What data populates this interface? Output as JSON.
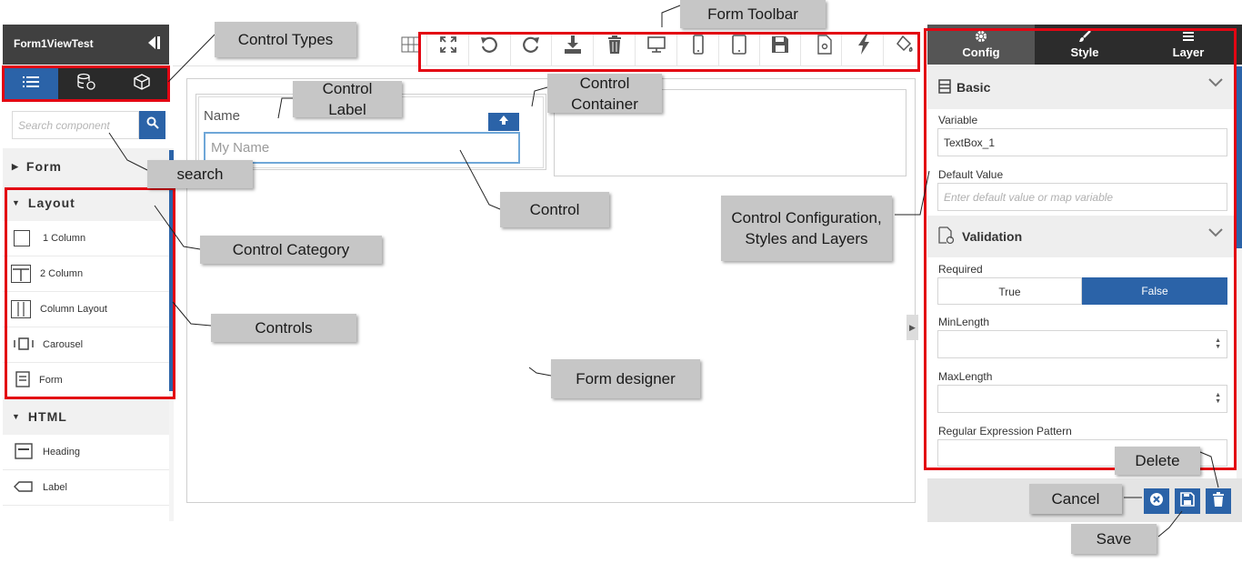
{
  "sidebar": {
    "title": "Form1ViewTest",
    "control_types": [
      {
        "icon": "list-icon",
        "active": true
      },
      {
        "icon": "database-icon",
        "active": false
      },
      {
        "icon": "cube-icon",
        "active": false
      }
    ],
    "search_placeholder": "Search component",
    "categories": [
      {
        "label": "Form",
        "expanded": false,
        "items": []
      },
      {
        "label": "Layout",
        "expanded": true,
        "items": [
          {
            "label": "1 Column",
            "icon": "one-column-icon"
          },
          {
            "label": "2 Column",
            "icon": "two-column-icon"
          },
          {
            "label": "Column Layout",
            "icon": "column-layout-icon"
          },
          {
            "label": "Carousel",
            "icon": "carousel-icon"
          },
          {
            "label": "Form",
            "icon": "form-icon"
          }
        ]
      },
      {
        "label": "HTML",
        "expanded": true,
        "items": [
          {
            "label": "Heading",
            "icon": "heading-icon"
          },
          {
            "label": "Label",
            "icon": "label-icon"
          }
        ]
      }
    ]
  },
  "toolbar": {
    "buttons": [
      "grid-icon",
      "fullscreen-icon",
      "undo-icon",
      "redo-icon",
      "download-icon",
      "trash-icon",
      "desktop-icon",
      "mobile-icon",
      "tablet-icon",
      "save-icon",
      "settings-file-icon",
      "lightning-icon",
      "paint-bucket-icon"
    ]
  },
  "canvas": {
    "control_label": "Name",
    "control_placeholder": "My Name"
  },
  "properties": {
    "tabs": [
      {
        "label": "Config",
        "icon": "gear-icon",
        "active": true
      },
      {
        "label": "Style",
        "icon": "brush-icon",
        "active": false
      },
      {
        "label": "Layer",
        "icon": "layers-icon",
        "active": false
      }
    ],
    "basic": {
      "title": "Basic",
      "variable_label": "Variable",
      "variable_value": "TextBox_1",
      "default_label": "Default Value",
      "default_placeholder": "Enter default value or map variable"
    },
    "validation": {
      "title": "Validation",
      "required_label": "Required",
      "true_label": "True",
      "false_label": "False",
      "selected": "False",
      "minlength_label": "MinLength",
      "maxlength_label": "MaxLength",
      "regex_label": "Regular Expression Pattern"
    }
  },
  "footer": {
    "buttons": [
      "cancel-icon",
      "save-icon",
      "delete-icon"
    ]
  },
  "annotations": {
    "control_types": "Control Types",
    "form_toolbar": "Form Toolbar",
    "control_label": "Control Label",
    "control_container": "Control Container",
    "search": "search",
    "control": "Control",
    "control_config": "Control Configuration, Styles and Layers",
    "control_category": "Control Category",
    "controls": "Controls",
    "form_designer": "Form designer",
    "delete": "Delete",
    "cancel": "Cancel",
    "save": "Save"
  },
  "colors": {
    "accent": "#2b63a8",
    "dark_header": "#404040",
    "highlight": "#e30613",
    "callout_bg": "#c6c6c6"
  }
}
